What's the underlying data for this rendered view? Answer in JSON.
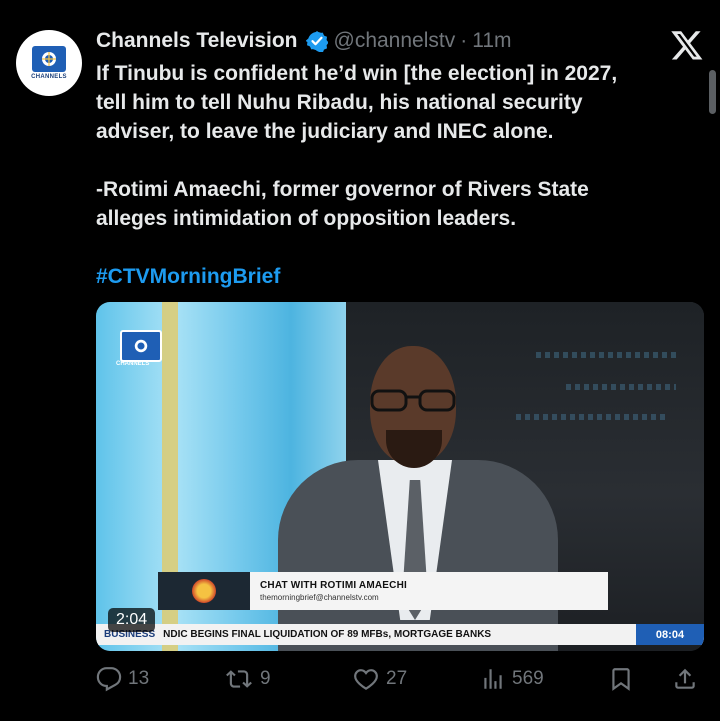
{
  "tweet": {
    "author_name": "Channels Television",
    "handle": "@channelstv",
    "separator": "·",
    "time": "11m",
    "text_lines": [
      "If Tinubu is confident he’d win [the election] in 2027,",
      "tell him to tell Nuhu Ribadu, his national security",
      "adviser, to leave the judiciary and INEC alone."
    ],
    "quote_lines": [
      "-Rotimi Amaechi, former governor of Rivers State",
      "alleges intimidation of opposition leaders."
    ],
    "hashtag": "#CTVMorningBrief"
  },
  "avatar": {
    "logo_text": "CHANNELS"
  },
  "media": {
    "channel_logo_text": "CHANNELS",
    "lower_third_title": "CHAT WITH ROTIMI AMAECHI",
    "lower_third_sub": "themorningbrief@channelstv.com",
    "ticker_label": "BUSINESS",
    "ticker_text": "NDIC BEGINS FINAL LIQUIDATION OF 89 MFBs, MORTGAGE BANKS",
    "ticker_time": "08:04",
    "duration": "2:04"
  },
  "actions": {
    "replies": "13",
    "reposts": "9",
    "likes": "27",
    "views": "569"
  },
  "colors": {
    "background": "#000000",
    "text": "#e7e9ea",
    "muted": "#71767b",
    "accent": "#1d9bf0"
  }
}
